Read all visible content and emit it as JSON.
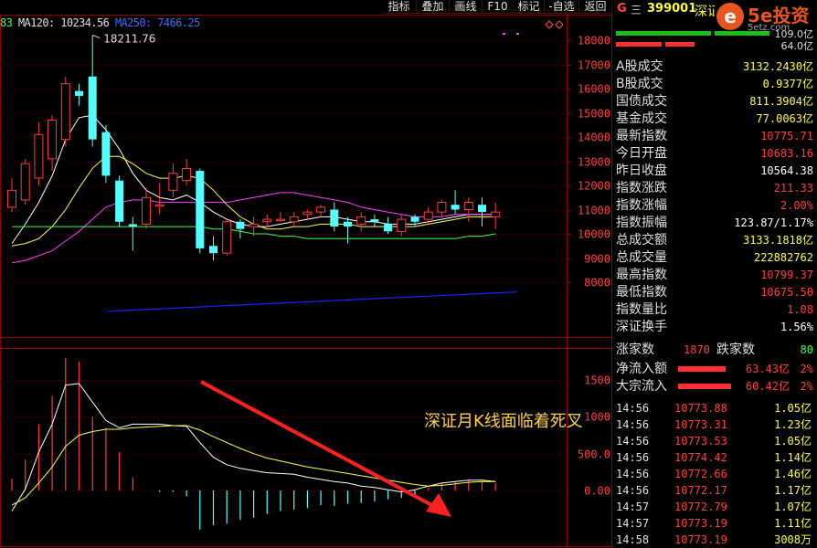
{
  "toolbar": {
    "buttons": [
      "指标",
      "叠加",
      "画线",
      "F10",
      "标记",
      "-自选",
      "返回"
    ]
  },
  "legend": {
    "prefix": "83",
    "ma120": "MA120: 10234.56",
    "ma250": "MA250: 7466.25"
  },
  "chart_data": {
    "type": "candlestick",
    "title": "",
    "y_ticks": [
      18000,
      17000,
      16000,
      15000,
      14000,
      13000,
      12000,
      11000,
      10000,
      9000,
      8000
    ],
    "high_label": "18211.76",
    "candles": [
      {
        "o": 11100,
        "c": 11800,
        "h": 12300,
        "l": 10900,
        "up": true
      },
      {
        "o": 11400,
        "c": 12900,
        "h": 13100,
        "l": 11200,
        "up": true
      },
      {
        "o": 12300,
        "c": 14100,
        "h": 14600,
        "l": 12000,
        "up": true
      },
      {
        "o": 13100,
        "c": 14700,
        "h": 14900,
        "l": 12600,
        "up": true
      },
      {
        "o": 13900,
        "c": 16200,
        "h": 16500,
        "l": 13600,
        "up": true
      },
      {
        "o": 15900,
        "c": 15700,
        "h": 16200,
        "l": 15300,
        "up": false
      },
      {
        "o": 16500,
        "c": 13900,
        "h": 18211,
        "l": 13600,
        "up": false
      },
      {
        "o": 14200,
        "c": 12400,
        "h": 14500,
        "l": 12100,
        "up": false
      },
      {
        "o": 12200,
        "c": 10500,
        "h": 12400,
        "l": 10300,
        "up": false
      },
      {
        "o": 10300,
        "c": 10400,
        "h": 10700,
        "l": 9300,
        "up": false
      },
      {
        "o": 10400,
        "c": 11500,
        "h": 11900,
        "l": 10200,
        "up": true
      },
      {
        "o": 11200,
        "c": 11200,
        "h": 12100,
        "l": 10800,
        "up": true
      },
      {
        "o": 11800,
        "c": 12500,
        "h": 12900,
        "l": 11500,
        "up": true
      },
      {
        "o": 12700,
        "c": 12200,
        "h": 13100,
        "l": 12000,
        "up": true
      },
      {
        "o": 12600,
        "c": 9400,
        "h": 12700,
        "l": 9200,
        "up": false
      },
      {
        "o": 9500,
        "c": 9200,
        "h": 9900,
        "l": 8900,
        "up": false
      },
      {
        "o": 9200,
        "c": 10500,
        "h": 10600,
        "l": 9100,
        "up": true
      },
      {
        "o": 10500,
        "c": 10200,
        "h": 10600,
        "l": 9800,
        "up": false
      },
      {
        "o": 10300,
        "c": 10400,
        "h": 10700,
        "l": 9900,
        "up": true
      },
      {
        "o": 10500,
        "c": 10600,
        "h": 10800,
        "l": 10300,
        "up": true
      },
      {
        "o": 10600,
        "c": 10600,
        "h": 10900,
        "l": 10500,
        "up": true
      },
      {
        "o": 10500,
        "c": 10700,
        "h": 10900,
        "l": 10300,
        "up": true
      },
      {
        "o": 10800,
        "c": 10900,
        "h": 11000,
        "l": 10600,
        "up": true
      },
      {
        "o": 10900,
        "c": 11100,
        "h": 11200,
        "l": 10700,
        "up": true
      },
      {
        "o": 11000,
        "c": 10300,
        "h": 11300,
        "l": 10100,
        "up": false
      },
      {
        "o": 10500,
        "c": 10300,
        "h": 10700,
        "l": 9600,
        "up": false
      },
      {
        "o": 10400,
        "c": 10700,
        "h": 10900,
        "l": 10100,
        "up": true
      },
      {
        "o": 10600,
        "c": 10500,
        "h": 10800,
        "l": 10300,
        "up": false
      },
      {
        "o": 10400,
        "c": 10100,
        "h": 10700,
        "l": 10000,
        "up": false
      },
      {
        "o": 10100,
        "c": 10600,
        "h": 10800,
        "l": 9900,
        "up": true
      },
      {
        "o": 10700,
        "c": 10500,
        "h": 10800,
        "l": 10300,
        "up": false
      },
      {
        "o": 10600,
        "c": 10900,
        "h": 11100,
        "l": 10400,
        "up": true
      },
      {
        "o": 10900,
        "c": 11300,
        "h": 11400,
        "l": 10700,
        "up": true
      },
      {
        "o": 11000,
        "c": 11200,
        "h": 11800,
        "l": 10800,
        "up": false
      },
      {
        "o": 11300,
        "c": 11000,
        "h": 11500,
        "l": 10500,
        "up": true
      },
      {
        "o": 11200,
        "c": 10900,
        "h": 11500,
        "l": 10300,
        "up": false
      },
      {
        "o": 10900,
        "c": 10700,
        "h": 11300,
        "l": 10200,
        "up": true
      }
    ],
    "ma_lines": [
      {
        "color": "#ffffff",
        "values": [
          9600,
          10400,
          11300,
          12400,
          13900,
          14800,
          14900,
          14300,
          13500,
          12500,
          11800,
          11500,
          11400,
          11600,
          11300,
          10900,
          10600,
          10400,
          10300,
          10300,
          10400,
          10500,
          10600,
          10700,
          10700,
          10600,
          10500,
          10500,
          10400,
          10400,
          10400,
          10500,
          10600,
          10700,
          10800,
          10800,
          10800
        ]
      },
      {
        "color": "#ffff40",
        "values": [
          9500,
          9600,
          9800,
          10300,
          11000,
          11900,
          12700,
          13200,
          13200,
          12900,
          12500,
          12300,
          12300,
          12400,
          12300,
          11800,
          11200,
          10700,
          10400,
          10200,
          10200,
          10300,
          10300,
          10400,
          10400,
          10400,
          10300,
          10300,
          10300,
          10300,
          10300,
          10400,
          10500,
          10600,
          10700,
          10700,
          10700
        ]
      },
      {
        "color": "#ff40ff",
        "values": [
          8800,
          8900,
          9100,
          9300,
          9700,
          10100,
          10600,
          11100,
          11300,
          11400,
          11400,
          11300,
          11300,
          11300,
          11300,
          11300,
          11300,
          11400,
          11500,
          11600,
          11700,
          11700,
          11600,
          11500,
          11400,
          11300,
          11100,
          11000,
          10900,
          10800,
          10700,
          10700,
          10700,
          10800,
          10800,
          10800,
          10800
        ]
      },
      {
        "color": "#40ff40",
        "values": [
          10300,
          10300,
          10300,
          10300,
          10300,
          10300,
          10300,
          10300,
          10300,
          10300,
          10300,
          10300,
          10300,
          10300,
          10300,
          10200,
          10200,
          10100,
          10000,
          10000,
          9900,
          9900,
          9800,
          9800,
          9800,
          9800,
          9800,
          9800,
          9800,
          9800,
          9800,
          9800,
          9800,
          9800,
          9900,
          9900,
          10000
        ]
      }
    ],
    "ma250_line": {
      "color": "#2020ff",
      "start": 6800,
      "end": 7600
    },
    "macd": {
      "y_ticks": [
        1500,
        1000,
        500,
        0
      ],
      "y_tick_labels": [
        "1500",
        "1000",
        "500.0",
        "0.00"
      ],
      "bars": [
        160,
        420,
        900,
        1280,
        1800,
        1750,
        1000,
        850,
        520,
        180,
        0,
        -20,
        -20,
        -80,
        -530,
        -470,
        -450,
        -400,
        -370,
        -320,
        -280,
        -260,
        -240,
        -200,
        -210,
        -180,
        -170,
        -150,
        -120,
        -100,
        -60,
        40,
        100,
        120,
        130,
        120,
        100
      ],
      "dif": [
        -280,
        20,
        520,
        900,
        1430,
        1450,
        1200,
        950,
        850,
        900,
        900,
        900,
        880,
        870,
        650,
        450,
        350,
        300,
        270,
        240,
        230,
        220,
        180,
        150,
        120,
        100,
        60,
        40,
        10,
        -20,
        10,
        60,
        100,
        120,
        140,
        140,
        120
      ],
      "dea": [
        -200,
        -100,
        100,
        320,
        600,
        750,
        800,
        830,
        830,
        850,
        860,
        870,
        880,
        880,
        820,
        730,
        650,
        570,
        500,
        440,
        400,
        360,
        320,
        290,
        260,
        230,
        200,
        170,
        140,
        110,
        80,
        60,
        70,
        90,
        110,
        120,
        120
      ]
    }
  },
  "annotation": "深证月K线面临着死叉",
  "right_panel": {
    "icon_label": "G",
    "grid_glyph": "三",
    "code": "399001",
    "name": "深证成指",
    "logo_text": "5e投资",
    "logo_sub": "5etz.com",
    "bar_values": [
      "109.0亿",
      "64.0亿"
    ],
    "stats": [
      {
        "label": "A股成交",
        "value": "3132.2430亿",
        "color": "#ffff40"
      },
      {
        "label": "B股成交",
        "value": "0.9377亿",
        "color": "#ffff40"
      },
      {
        "label": "国债成交",
        "value": "811.3904亿",
        "color": "#ffff40"
      },
      {
        "label": "基金成交",
        "value": "77.0063亿",
        "color": "#ffff40"
      },
      {
        "label": "最新指数",
        "value": "10775.71",
        "color": "#ff4040"
      },
      {
        "label": "今日开盘",
        "value": "10683.16",
        "color": "#ff4040"
      },
      {
        "label": "昨日收盘",
        "value": "10564.38",
        "color": "#ffffff"
      },
      {
        "label": "指数涨跌",
        "value": "211.33",
        "color": "#ff4040"
      },
      {
        "label": "指数涨幅",
        "value": "2.00%",
        "color": "#ff4040"
      },
      {
        "label": "指数振幅",
        "value": "123.87/1.17%",
        "color": "#ffffff"
      },
      {
        "label": "总成交额",
        "value": "3133.1818亿",
        "color": "#ffff40"
      },
      {
        "label": "总成交量",
        "value": "222882762",
        "color": "#ffff40"
      },
      {
        "label": "最高指数",
        "value": "10799.37",
        "color": "#ff4040"
      },
      {
        "label": "最低指数",
        "value": "10675.50",
        "color": "#ff4040"
      },
      {
        "label": "指数量比",
        "value": "1.08",
        "color": "#ff4040"
      },
      {
        "label": "深证换手",
        "value": "1.56%",
        "color": "#ffffff"
      }
    ],
    "breadth": {
      "up_label": "涨家数",
      "up_value": "1870",
      "down_label": "跌家数",
      "down_value": "80"
    },
    "flows": [
      {
        "label": "净流入额",
        "value": "63.43亿",
        "pct": "2%"
      },
      {
        "label": "大宗流入",
        "value": "60.42亿",
        "pct": "2%"
      }
    ],
    "ticks": [
      {
        "time": "14:56",
        "price": "10773.88",
        "vol": "1.05亿"
      },
      {
        "time": "14:56",
        "price": "10773.31",
        "vol": "1.23亿"
      },
      {
        "time": "14:56",
        "price": "10773.53",
        "vol": "1.05亿"
      },
      {
        "time": "14:56",
        "price": "10774.42",
        "vol": "1.14亿"
      },
      {
        "time": "14:56",
        "price": "10772.66",
        "vol": "1.46亿"
      },
      {
        "time": "14:56",
        "price": "10772.17",
        "vol": "1.17亿"
      },
      {
        "time": "14:57",
        "price": "10772.79",
        "vol": "1.07亿"
      },
      {
        "time": "14:57",
        "price": "10773.19",
        "vol": "1.11亿"
      },
      {
        "time": "14:58",
        "price": "10773.19",
        "vol": "3008万"
      }
    ]
  }
}
